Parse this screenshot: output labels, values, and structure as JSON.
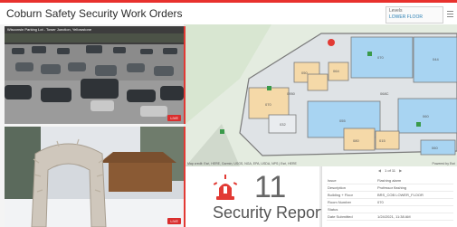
{
  "header": {
    "title": "Coburn Safety Security Work Orders",
    "level_label": "Levels",
    "level_value": "LOWER FLOOR"
  },
  "cameras": [
    {
      "label": "Wisconsin Parking Lot - Tower Junction, Yellowstone",
      "badge": "LIVE"
    },
    {
      "label": "",
      "badge": "LIVE"
    }
  ],
  "map": {
    "attribution": "Map credit: Esri, HERE, Garmin, USGS, NGA, EPA, USDA, NPS | Esri, HERE",
    "powered_by": "Powered by Esri",
    "rooms": [
      "070",
      "044",
      "050",
      "064",
      "070",
      "055",
      "060",
      "068C",
      "080",
      "032",
      "0950",
      "015",
      "060"
    ],
    "colors": {
      "floor": "#dfe3e6",
      "blue_room": "#a8d4f2",
      "tan_room": "#f5d9a8",
      "wall": "#7a7a7a",
      "park": "#dbe8d6"
    }
  },
  "stat": {
    "value": "11",
    "label": "Security Reports",
    "accent": "#e23a34"
  },
  "details": {
    "pager": "1 of 11",
    "rows": [
      {
        "k": "Issue",
        "v": "Flashing alarm"
      },
      {
        "k": "Description",
        "v": "Professor flashing"
      },
      {
        "k": "Building + Floor",
        "v": "BRS_COB LOWER_FLOOR"
      },
      {
        "k": "Room Number",
        "v": "070"
      },
      {
        "k": "Status",
        "v": ""
      },
      {
        "k": "Date Submitted",
        "v": "1/24/2021, 11:38 AM"
      }
    ]
  }
}
